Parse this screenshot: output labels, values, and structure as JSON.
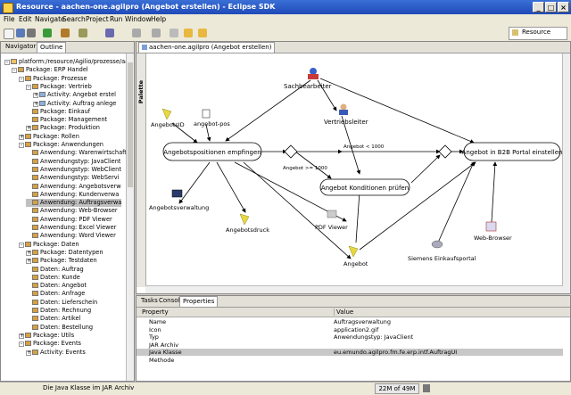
{
  "window": {
    "title": "Resource - aachen-one.agilpro (Angebot erstellen) - Eclipse SDK",
    "min": "_",
    "max": "□",
    "close": "×"
  },
  "menu": [
    "File",
    "Edit",
    "Navigate",
    "Search",
    "Project",
    "Run",
    "Window",
    "Help"
  ],
  "toolbar": {
    "perspective_label": "Resource"
  },
  "left_panel": {
    "tabs": [
      "Navigator",
      "Outline"
    ],
    "tree": [
      {
        "label": "platform:/resource/Agilio/prozesse/aach",
        "level": 0,
        "exp": "-"
      },
      {
        "label": "Package: ERP Handel",
        "level": 1,
        "exp": "-"
      },
      {
        "label": "Package: Prozesse",
        "level": 2,
        "exp": "-"
      },
      {
        "label": "Package: Vertrieb",
        "level": 3,
        "exp": "-"
      },
      {
        "label": "Activity: Angebot erstel",
        "level": 4,
        "exp": "+"
      },
      {
        "label": "Activity: Auftrag anlege",
        "level": 4,
        "exp": "+"
      },
      {
        "label": "Package: Einkauf",
        "level": 3,
        "exp": ""
      },
      {
        "label": "Package: Management",
        "level": 3,
        "exp": ""
      },
      {
        "label": "Package: Produktion",
        "level": 3,
        "exp": "+"
      },
      {
        "label": "Package: Rollen",
        "level": 2,
        "exp": "+"
      },
      {
        "label": "Package: Anwendungen",
        "level": 2,
        "exp": "-"
      },
      {
        "label": "Anwendung: Warenwirtschafts",
        "level": 3,
        "exp": ""
      },
      {
        "label": "Anwendungstyp: JavaClient",
        "level": 3,
        "exp": ""
      },
      {
        "label": "Anwendungstyp: WebClient",
        "level": 3,
        "exp": ""
      },
      {
        "label": "Anwendungstyp: WebServi",
        "level": 3,
        "exp": ""
      },
      {
        "label": "Anwendung: Angebotsverw",
        "level": 3,
        "exp": ""
      },
      {
        "label": "Anwendung: Kundenverwa",
        "level": 3,
        "exp": ""
      },
      {
        "label": "Anwendung: Auftragsverwa",
        "level": 3,
        "exp": "",
        "selected": true
      },
      {
        "label": "Anwendung: Web-Browser",
        "level": 3,
        "exp": ""
      },
      {
        "label": "Anwendung: PDF Viewer",
        "level": 3,
        "exp": ""
      },
      {
        "label": "Anwendung: Excel Viewer",
        "level": 3,
        "exp": ""
      },
      {
        "label": "Anwendung: Word Viewer",
        "level": 3,
        "exp": ""
      },
      {
        "label": "Package: Daten",
        "level": 2,
        "exp": "-"
      },
      {
        "label": "Package: Datentypen",
        "level": 3,
        "exp": "+"
      },
      {
        "label": "Package: Testdaten",
        "level": 3,
        "exp": "+"
      },
      {
        "label": "Daten: Auftrag",
        "level": 3,
        "exp": ""
      },
      {
        "label": "Daten: Kunde",
        "level": 3,
        "exp": ""
      },
      {
        "label": "Daten: Angebot",
        "level": 3,
        "exp": ""
      },
      {
        "label": "Daten: Anfrage",
        "level": 3,
        "exp": ""
      },
      {
        "label": "Daten: Lieferschein",
        "level": 3,
        "exp": ""
      },
      {
        "label": "Daten: Rechnung",
        "level": 3,
        "exp": ""
      },
      {
        "label": "Daten: Artikel",
        "level": 3,
        "exp": ""
      },
      {
        "label": "Daten: Bestellung",
        "level": 3,
        "exp": ""
      },
      {
        "label": "Package: Utils",
        "level": 2,
        "exp": "+"
      },
      {
        "label": "Package: Events",
        "level": 2,
        "exp": "-"
      },
      {
        "label": "Activity: Events",
        "level": 3,
        "exp": "+"
      }
    ]
  },
  "editor": {
    "tab_label": "aachen-one.agilpro (Angebot erstellen)",
    "palette_label": "Palette",
    "nodes": {
      "n1": "Angebotspositionen empfingen",
      "n2": "Angebot Konditionen prüfen",
      "n3": "Angebot in B2B Portal einstellen"
    },
    "labels": {
      "sachbearbeiter": "Sachbearbeiter",
      "vertriebsleiter": "Vertriebsleiter",
      "angebotsid": "AngebotsID",
      "angebotpos": "angebot-pos",
      "angebotsverwaltung": "Angebotsverwaltung",
      "angebotsdruck": "Angebotsdruck",
      "pdfviewer": "PDF Viewer",
      "angebot": "Angebot",
      "siemens": "Siemens Einkaufsportal",
      "webbrowser": "Web-Browser",
      "cond1": "Angebot >= 1000",
      "cond2": "Angebot < 1000"
    }
  },
  "bottom": {
    "tabs": [
      "Tasks",
      "Console",
      "Properties"
    ],
    "headers": [
      "Property",
      "Value"
    ],
    "rows": [
      {
        "k": "Name",
        "v": "Auftragsverwaltung"
      },
      {
        "k": "Icon",
        "v": "application2.gif"
      },
      {
        "k": "Typ",
        "v": "Anwendungstyp: JavaClient"
      },
      {
        "k": "JAR Archiv",
        "v": ""
      },
      {
        "k": "Java Klasse",
        "v": "eu.emundo.agilpro.fm.fe.erp.intf.AuftragUI",
        "selected": true
      },
      {
        "k": "Methode",
        "v": ""
      }
    ]
  },
  "status": {
    "message": "Die Java Klasse im JAR Archiv",
    "memory": "22M of 49M"
  }
}
